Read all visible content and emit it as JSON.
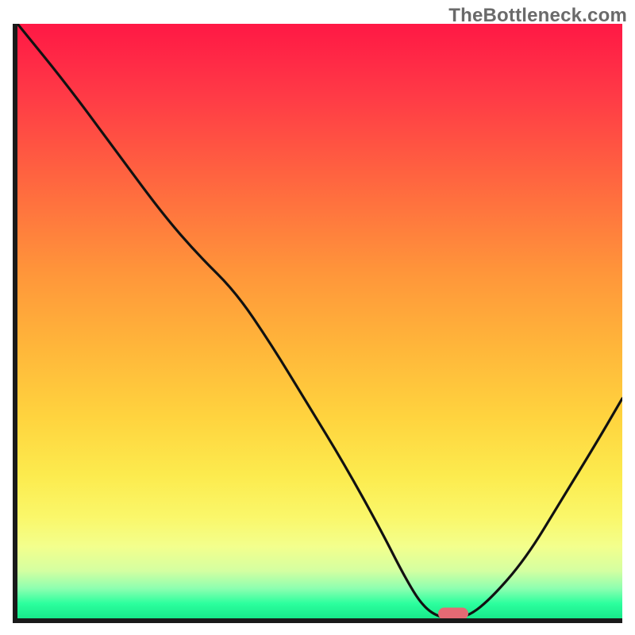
{
  "watermark": "TheBottleneck.com",
  "colors": {
    "gradient_top": "#ff1845",
    "gradient_mid": "#ffd33e",
    "gradient_low": "#faf76a",
    "gradient_bottom": "#17e88a",
    "curve": "#111111",
    "marker": "#e46a74",
    "axis": "#1a1a1a"
  },
  "chart_data": {
    "type": "line",
    "title": "",
    "xlabel": "",
    "ylabel": "",
    "xlim": [
      0,
      100
    ],
    "ylim": [
      0,
      100
    ],
    "series": [
      {
        "name": "bottleneck-curve",
        "x": [
          0,
          8,
          16,
          24,
          30,
          36,
          42,
          48,
          54,
          60,
          64,
          67,
          70,
          74,
          78,
          84,
          90,
          96,
          100
        ],
        "y": [
          100,
          90,
          79,
          68,
          61,
          55,
          46,
          36,
          26,
          15,
          7,
          2,
          0,
          0,
          3,
          10,
          20,
          30,
          37
        ]
      }
    ],
    "marker": {
      "x": 72,
      "y": 0.8
    },
    "notes": "x and y are in percent of plot width/height; y=0 is bottom (green), y=100 is top (red)."
  }
}
